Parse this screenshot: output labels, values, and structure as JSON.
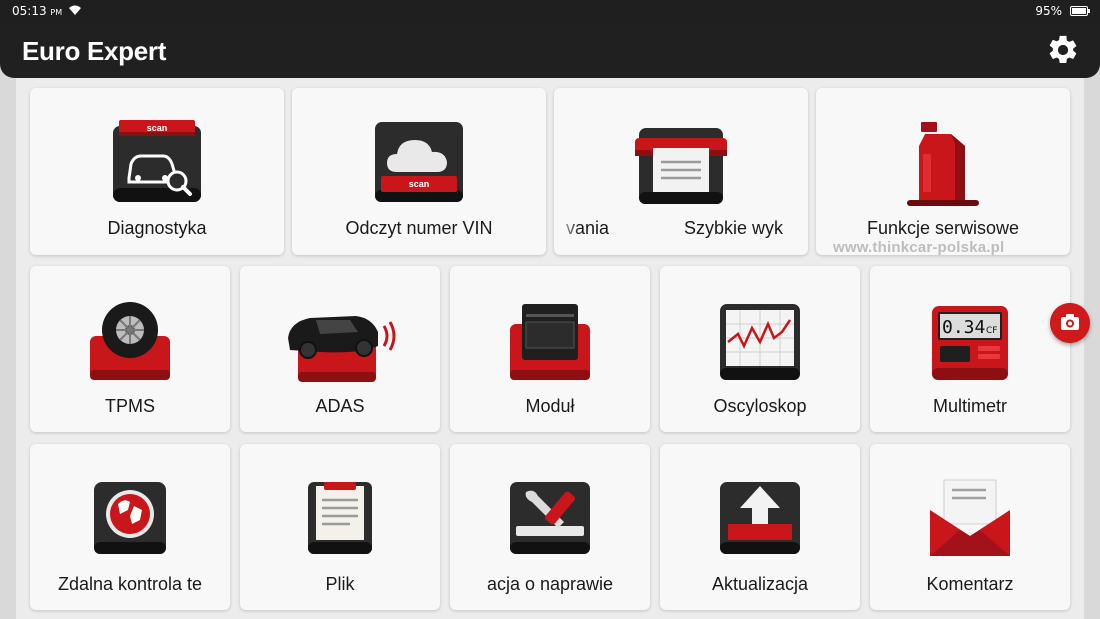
{
  "status": {
    "time": "05:13",
    "ampm": "PM",
    "battery": "95%"
  },
  "app": {
    "title": "Euro Expert"
  },
  "watermark": "www.thinkcar-polska.pl",
  "icons": {
    "status": [
      "wifi-icon",
      "battery-icon"
    ],
    "appbar": "gear-icon",
    "floating": "camera-icon"
  },
  "colors": {
    "accent": "#d0191b",
    "appbar": "#202020",
    "tile": "#f8f8f8"
  },
  "tiles": [
    {
      "label": "Diagnostyka",
      "icon": "car-scan-icon",
      "badge": "scan"
    },
    {
      "label": "Odczyt numer VIN",
      "icon": "cloud-scan-icon",
      "badge": "scan"
    },
    {
      "label_start": "vania",
      "label_end": "Szybkie wyk",
      "icon": "printer-icon"
    },
    {
      "label": "Funkcje serwisowe",
      "icon": "oil-canister-icon"
    },
    {
      "label": "TPMS",
      "icon": "tire-icon"
    },
    {
      "label": "ADAS",
      "icon": "car-sensor-icon"
    },
    {
      "label": "Moduł",
      "icon": "module-icon"
    },
    {
      "label": "Oscyloskop",
      "icon": "oscilloscope-icon"
    },
    {
      "label": "Multimetr",
      "icon": "multimeter-icon",
      "display": "0.34",
      "unit": "CF"
    },
    {
      "label": "Zdalna kontrola te",
      "icon": "remote-globe-icon"
    },
    {
      "label": "Plik",
      "icon": "clipboard-icon"
    },
    {
      "label": "acja o naprawie",
      "icon": "repair-tools-icon"
    },
    {
      "label": "Aktualizacja",
      "icon": "update-upload-icon"
    },
    {
      "label": "Komentarz",
      "icon": "mail-envelope-icon"
    }
  ]
}
